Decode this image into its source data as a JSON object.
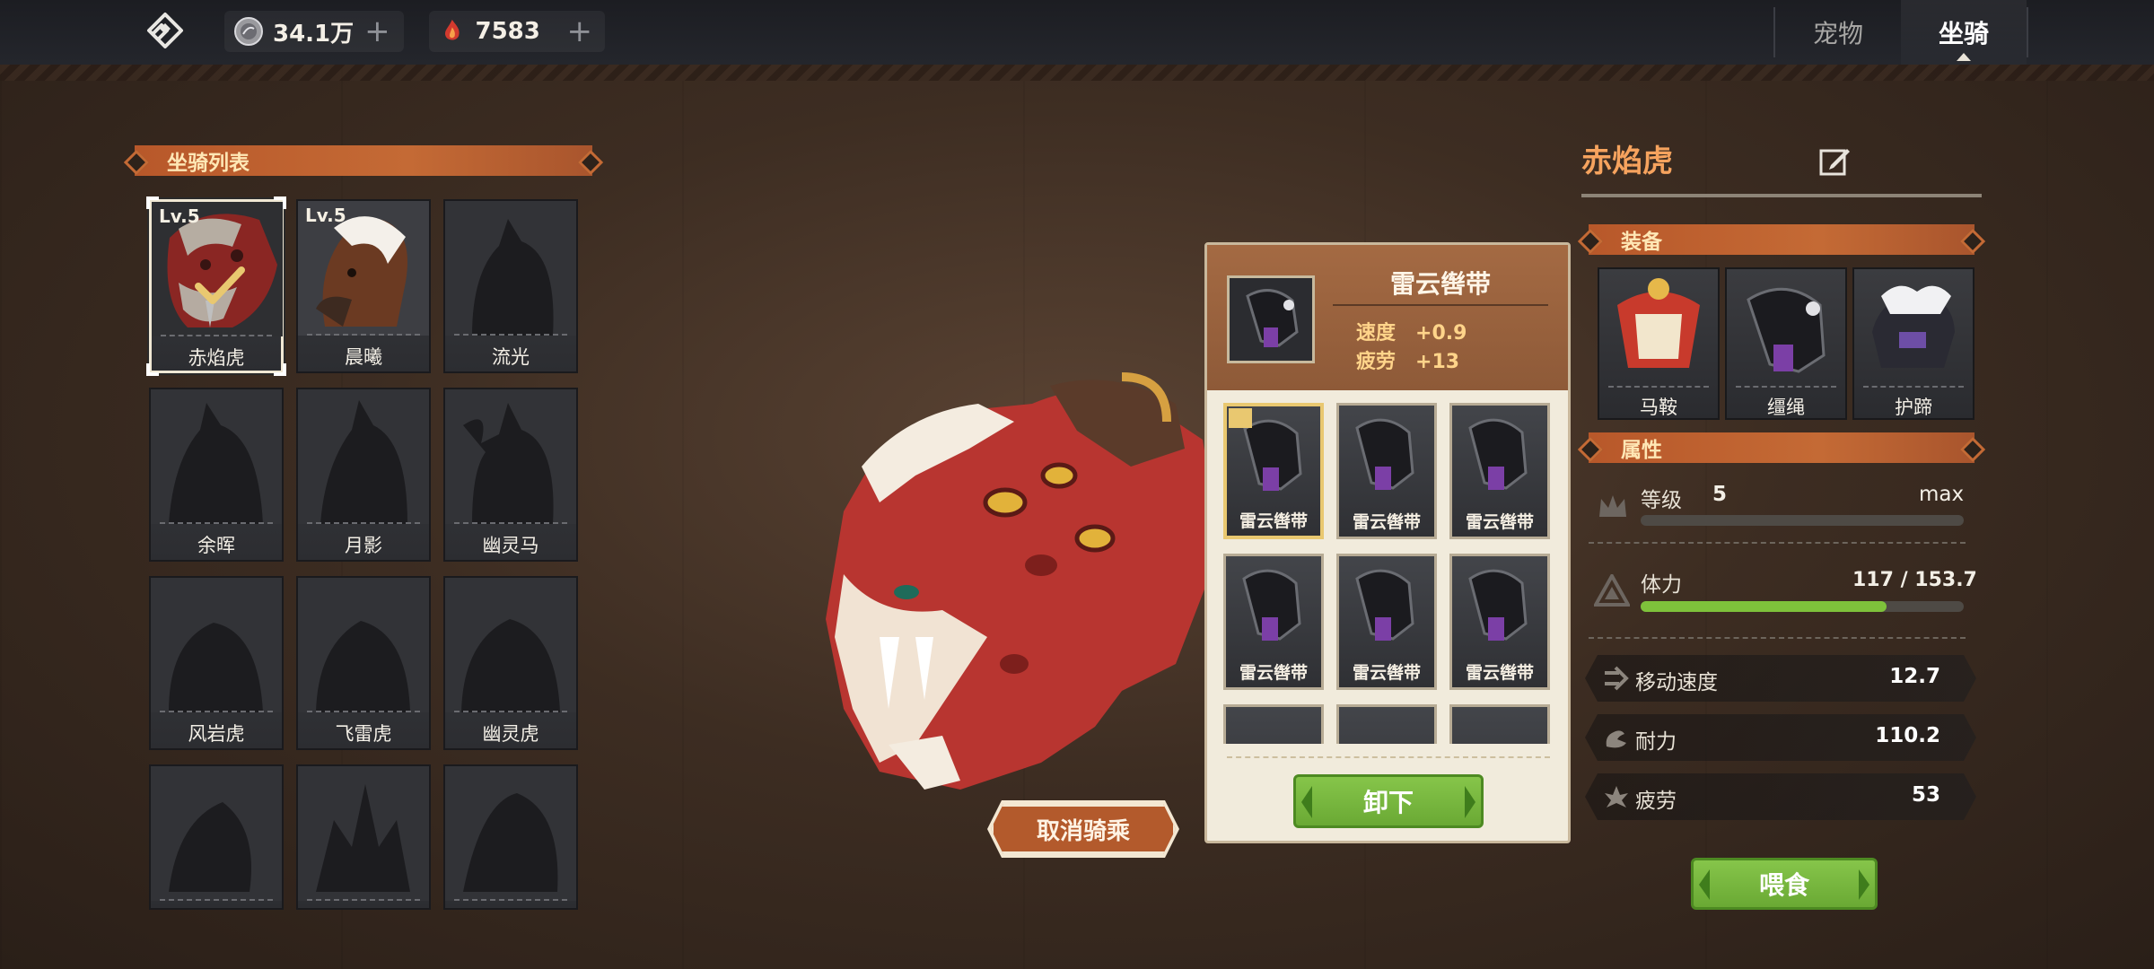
{
  "topbar": {
    "currency1": {
      "value": "34.1万",
      "icon": "silver-coin-icon"
    },
    "currency2": {
      "value": "7583",
      "icon": "fire-crystal-icon"
    },
    "tabs": [
      {
        "label": "宠物",
        "active": false
      },
      {
        "label": "坐骑",
        "active": true
      }
    ]
  },
  "mount_list": {
    "title": "坐骑列表",
    "items": [
      {
        "name": "赤焰虎",
        "level": "Lv.5",
        "unlocked": true,
        "selected": true
      },
      {
        "name": "晨曦",
        "level": "Lv.5",
        "unlocked": true,
        "selected": false
      },
      {
        "name": "流光",
        "level": "",
        "unlocked": false
      },
      {
        "name": "余晖",
        "level": "",
        "unlocked": false
      },
      {
        "name": "月影",
        "level": "",
        "unlocked": false
      },
      {
        "name": "幽灵马",
        "level": "",
        "unlocked": false
      },
      {
        "name": "风岩虎",
        "level": "",
        "unlocked": false
      },
      {
        "name": "飞雷虎",
        "level": "",
        "unlocked": false
      },
      {
        "name": "幽灵虎",
        "level": "",
        "unlocked": false
      },
      {
        "name": "",
        "level": "",
        "unlocked": false
      },
      {
        "name": "",
        "level": "",
        "unlocked": false
      },
      {
        "name": "",
        "level": "",
        "unlocked": false
      }
    ]
  },
  "center": {
    "cancel_ride_label": "取消骑乘"
  },
  "equip_popup": {
    "title": "雷云辔带",
    "stats": [
      {
        "label": "速度",
        "value": "+0.9"
      },
      {
        "label": "疲劳",
        "value": "+13"
      }
    ],
    "items": [
      {
        "name": "雷云辔带",
        "selected": true
      },
      {
        "name": "雷云辔带",
        "selected": false
      },
      {
        "name": "雷云辔带",
        "selected": false
      },
      {
        "name": "雷云辔带",
        "selected": false
      },
      {
        "name": "雷云辔带",
        "selected": false
      },
      {
        "name": "雷云辔带",
        "selected": false
      },
      {
        "name": "",
        "selected": false
      },
      {
        "name": "",
        "selected": false
      },
      {
        "name": "",
        "selected": false
      }
    ],
    "unequip_label": "卸下"
  },
  "details": {
    "mount_name": "赤焰虎",
    "equipment_title": "装备",
    "equipment": [
      {
        "name": "马鞍",
        "icon": "saddle-icon"
      },
      {
        "name": "缰绳",
        "icon": "bridle-icon"
      },
      {
        "name": "护蹄",
        "icon": "hoof-guard-icon"
      }
    ],
    "attributes_title": "属性",
    "level": {
      "label": "等级",
      "value": "5",
      "max_label": "max"
    },
    "stamina": {
      "label": "体力",
      "value": "117 / 153.7",
      "fraction": 0.761
    },
    "stats": [
      {
        "label": "移动速度",
        "value": "12.7",
        "icon": "speed-arrow-icon"
      },
      {
        "label": "耐力",
        "value": "110.2",
        "icon": "arm-icon"
      },
      {
        "label": "疲劳",
        "value": "53",
        "icon": "fatigue-icon"
      }
    ],
    "feed_label": "喂食"
  },
  "colors": {
    "accent_orange": "#c46a35",
    "green_button": "#7ab83f",
    "title_orange": "#f6a35e",
    "popup_bg": "#f1ebdc"
  }
}
